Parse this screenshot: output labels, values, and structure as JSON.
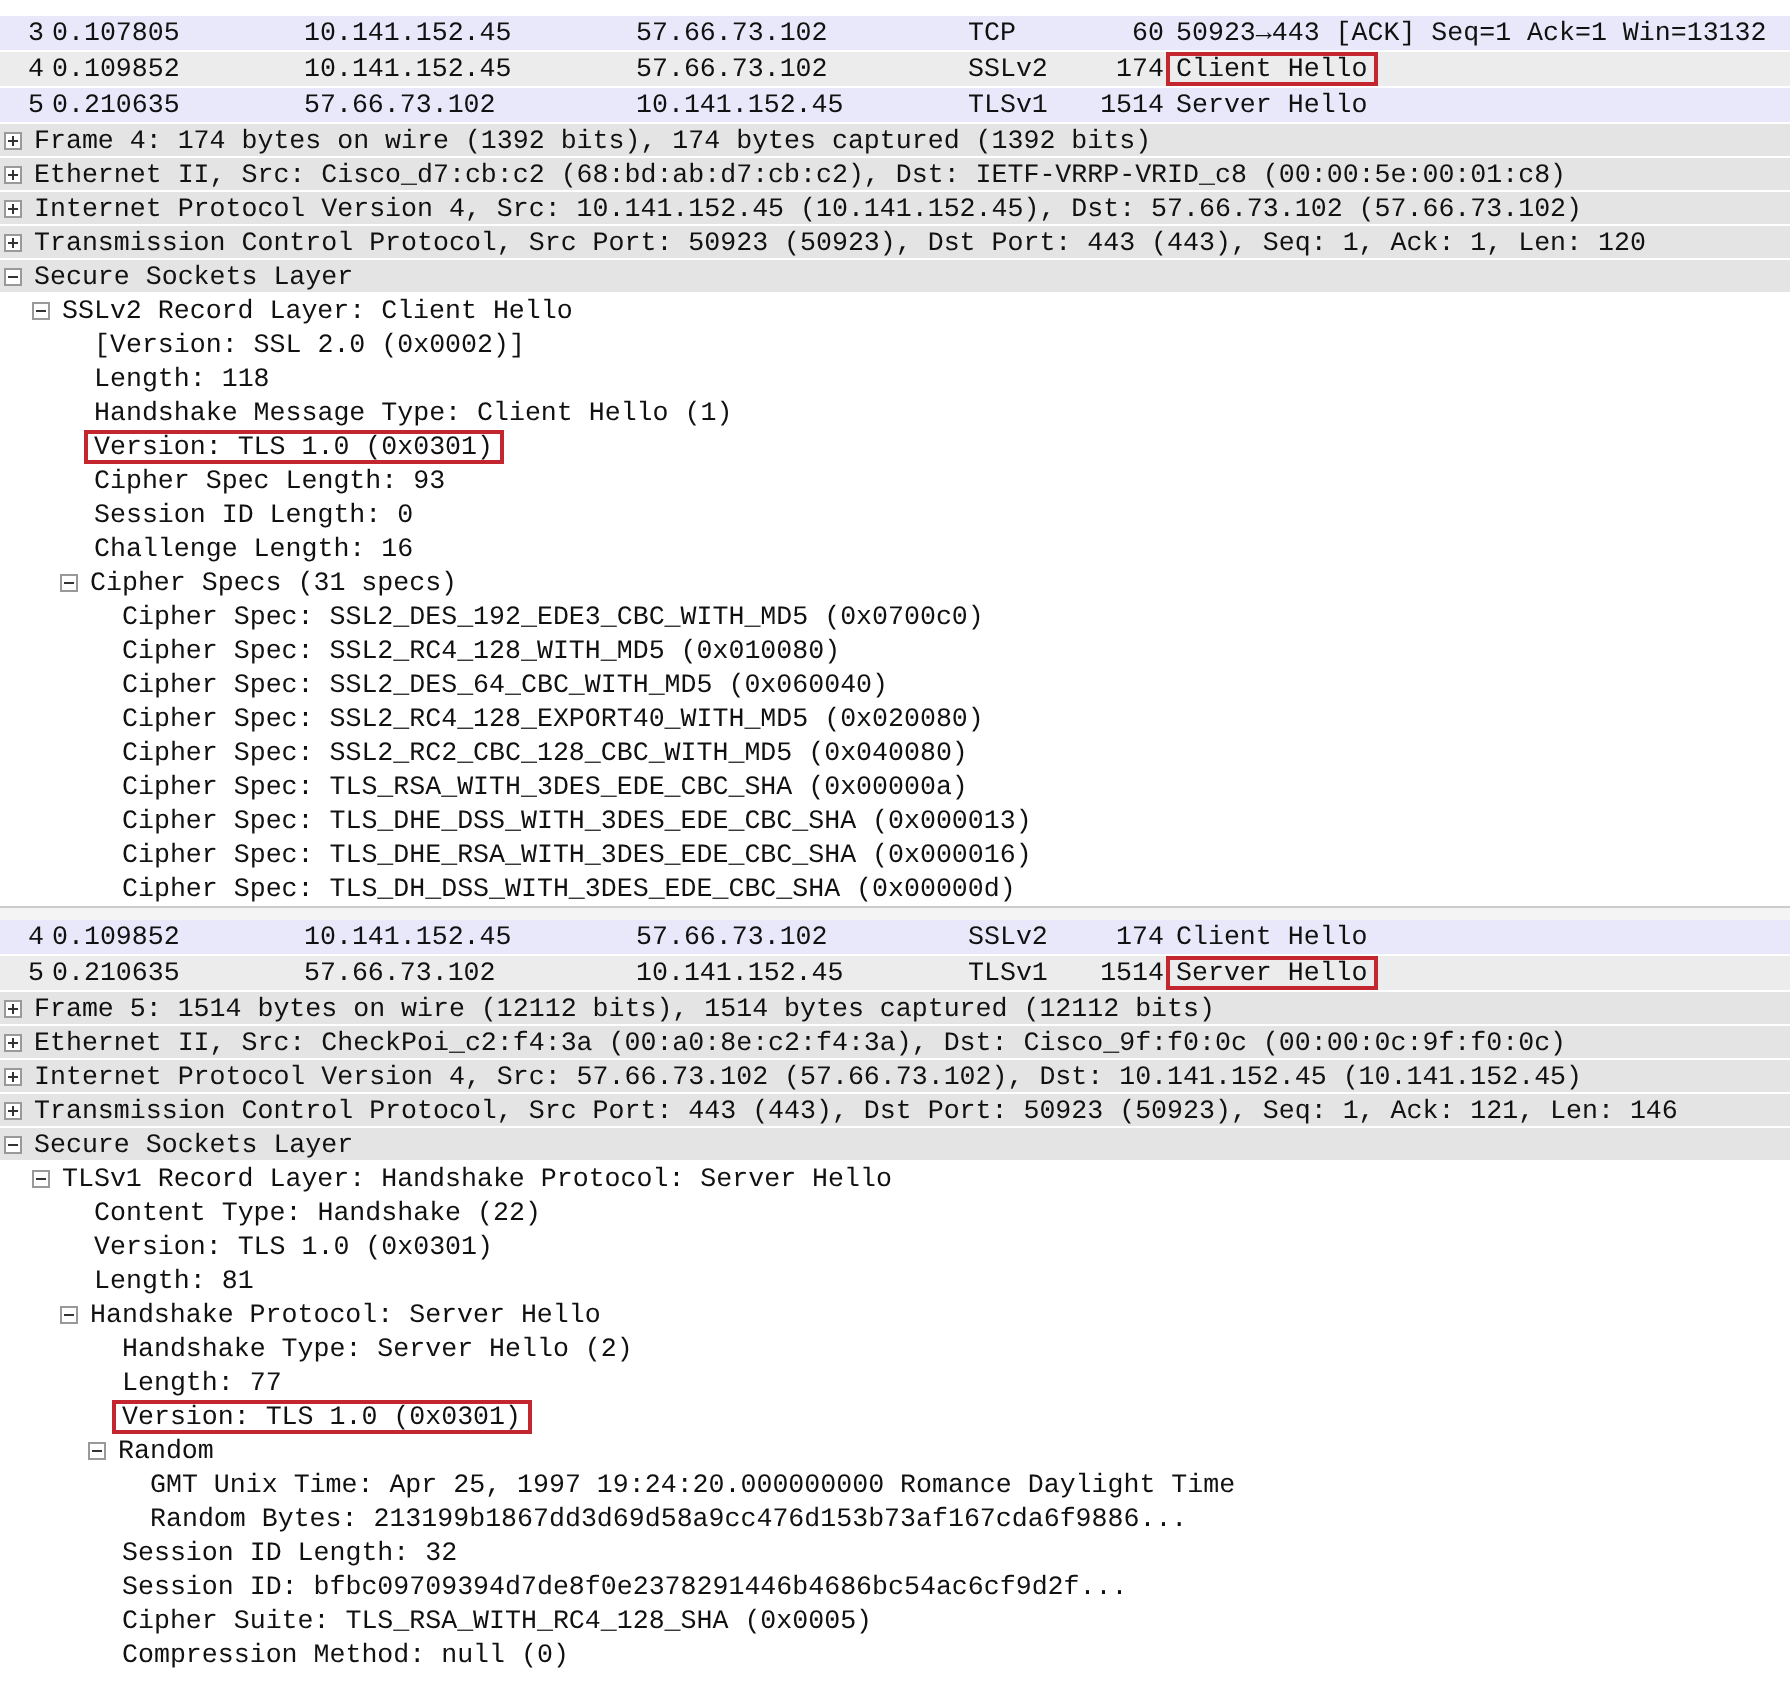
{
  "captures": [
    {
      "packet_list": [
        {
          "number": "3",
          "time": "0.107805",
          "source": "10.141.152.45",
          "destination": "57.66.73.102",
          "protocol": "TCP",
          "length": "60",
          "info": "50923→443 [ACK] Seq=1 Ack=1 Win=13132",
          "selected": false,
          "highlighted": false
        },
        {
          "number": "4",
          "time": "0.109852",
          "source": "10.141.152.45",
          "destination": "57.66.73.102",
          "protocol": "SSLv2",
          "length": "174",
          "info": "Client Hello",
          "selected": true,
          "highlighted": true
        },
        {
          "number": "5",
          "time": "0.210635",
          "source": "57.66.73.102",
          "destination": "10.141.152.45",
          "protocol": "TLSv1",
          "length": "1514",
          "info": "Server Hello",
          "selected": false,
          "highlighted": false
        }
      ],
      "details": [
        {
          "text": "Frame 4: 174 bytes on wire (1392 bits), 174 bytes captured (1392 bits)",
          "expanded": false,
          "highlighted": false
        },
        {
          "text": "Ethernet II, Src: Cisco_d7:cb:c2 (68:bd:ab:d7:cb:c2), Dst: IETF-VRRP-VRID_c8 (00:00:5e:00:01:c8)",
          "expanded": false,
          "highlighted": false
        },
        {
          "text": "Internet Protocol Version 4, Src: 10.141.152.45 (10.141.152.45), Dst: 57.66.73.102 (57.66.73.102)",
          "expanded": false,
          "highlighted": false
        },
        {
          "text": "Transmission Control Protocol, Src Port: 50923 (50923), Dst Port: 443 (443), Seq: 1, Ack: 1, Len: 120",
          "expanded": false,
          "highlighted": false
        },
        {
          "text": "Secure Sockets Layer",
          "expanded": true,
          "highlighted": false,
          "children": [
            {
              "text": "SSLv2 Record Layer: Client Hello",
              "expanded": true,
              "highlighted": false,
              "children": [
                {
                  "text": "[Version: SSL 2.0 (0x0002)]",
                  "highlighted": false
                },
                {
                  "text": "Length: 118",
                  "highlighted": false
                },
                {
                  "text": "Handshake Message Type: Client Hello (1)",
                  "highlighted": false
                },
                {
                  "text": "Version: TLS 1.0 (0x0301)",
                  "highlighted": true
                },
                {
                  "text": "Cipher Spec Length: 93",
                  "highlighted": false
                },
                {
                  "text": "Session ID Length: 0",
                  "highlighted": false
                },
                {
                  "text": "Challenge Length: 16",
                  "highlighted": false
                },
                {
                  "text": "Cipher Specs (31 specs)",
                  "expanded": true,
                  "highlighted": false,
                  "children": [
                    {
                      "text": "Cipher Spec: SSL2_DES_192_EDE3_CBC_WITH_MD5 (0x0700c0)",
                      "highlighted": false
                    },
                    {
                      "text": "Cipher Spec: SSL2_RC4_128_WITH_MD5 (0x010080)",
                      "highlighted": false
                    },
                    {
                      "text": "Cipher Spec: SSL2_DES_64_CBC_WITH_MD5 (0x060040)",
                      "highlighted": false
                    },
                    {
                      "text": "Cipher Spec: SSL2_RC4_128_EXPORT40_WITH_MD5 (0x020080)",
                      "highlighted": false
                    },
                    {
                      "text": "Cipher Spec: SSL2_RC2_CBC_128_CBC_WITH_MD5 (0x040080)",
                      "highlighted": false
                    },
                    {
                      "text": "Cipher Spec: TLS_RSA_WITH_3DES_EDE_CBC_SHA (0x00000a)",
                      "highlighted": false
                    },
                    {
                      "text": "Cipher Spec: TLS_DHE_DSS_WITH_3DES_EDE_CBC_SHA (0x000013)",
                      "highlighted": false
                    },
                    {
                      "text": "Cipher Spec: TLS_DHE_RSA_WITH_3DES_EDE_CBC_SHA (0x000016)",
                      "highlighted": false
                    },
                    {
                      "text": "Cipher Spec: TLS_DH_DSS_WITH_3DES_EDE_CBC_SHA (0x00000d)",
                      "highlighted": false
                    }
                  ]
                }
              ]
            }
          ]
        }
      ]
    },
    {
      "packet_list": [
        {
          "number": "4",
          "time": "0.109852",
          "source": "10.141.152.45",
          "destination": "57.66.73.102",
          "protocol": "SSLv2",
          "length": "174",
          "info": "Client Hello",
          "selected": false,
          "highlighted": false
        },
        {
          "number": "5",
          "time": "0.210635",
          "source": "57.66.73.102",
          "destination": "10.141.152.45",
          "protocol": "TLSv1",
          "length": "1514",
          "info": "Server Hello",
          "selected": true,
          "highlighted": true
        }
      ],
      "details": [
        {
          "text": "Frame 5: 1514 bytes on wire (12112 bits), 1514 bytes captured (12112 bits)",
          "expanded": false,
          "highlighted": false
        },
        {
          "text": "Ethernet II, Src: CheckPoi_c2:f4:3a (00:a0:8e:c2:f4:3a), Dst: Cisco_9f:f0:0c (00:00:0c:9f:f0:0c)",
          "expanded": false,
          "highlighted": false
        },
        {
          "text": "Internet Protocol Version 4, Src: 57.66.73.102 (57.66.73.102), Dst: 10.141.152.45 (10.141.152.45)",
          "expanded": false,
          "highlighted": false
        },
        {
          "text": "Transmission Control Protocol, Src Port: 443 (443), Dst Port: 50923 (50923), Seq: 1, Ack: 121, Len: 146",
          "expanded": false,
          "highlighted": false
        },
        {
          "text": "Secure Sockets Layer",
          "expanded": true,
          "highlighted": false,
          "children": [
            {
              "text": "TLSv1 Record Layer: Handshake Protocol: Server Hello",
              "expanded": true,
              "highlighted": false,
              "children": [
                {
                  "text": "Content Type: Handshake (22)",
                  "highlighted": false
                },
                {
                  "text": "Version: TLS 1.0 (0x0301)",
                  "highlighted": false
                },
                {
                  "text": "Length: 81",
                  "highlighted": false
                },
                {
                  "text": "Handshake Protocol: Server Hello",
                  "expanded": true,
                  "highlighted": false,
                  "children": [
                    {
                      "text": "Handshake Type: Server Hello (2)",
                      "highlighted": false
                    },
                    {
                      "text": "Length: 77",
                      "highlighted": false
                    },
                    {
                      "text": "Version: TLS 1.0 (0x0301)",
                      "highlighted": true
                    },
                    {
                      "text": "Random",
                      "expanded": true,
                      "highlighted": false,
                      "children": [
                        {
                          "text": "GMT Unix Time: Apr 25, 1997 19:24:20.000000000 Romance Daylight Time",
                          "highlighted": false
                        },
                        {
                          "text": "Random Bytes: 213199b1867dd3d69d58a9cc476d153b73af167cda6f9886...",
                          "highlighted": false
                        }
                      ]
                    },
                    {
                      "text": "Session ID Length: 32",
                      "highlighted": false
                    },
                    {
                      "text": "Session ID: bfbc09709394d7de8f0e2378291446b4686bc54ac6cf9d2f...",
                      "highlighted": false
                    },
                    {
                      "text": "Cipher Suite: TLS_RSA_WITH_RC4_128_SHA (0x0005)",
                      "highlighted": false
                    },
                    {
                      "text": "Compression Method: null (0)",
                      "highlighted": false
                    }
                  ]
                }
              ]
            }
          ]
        }
      ]
    }
  ]
}
